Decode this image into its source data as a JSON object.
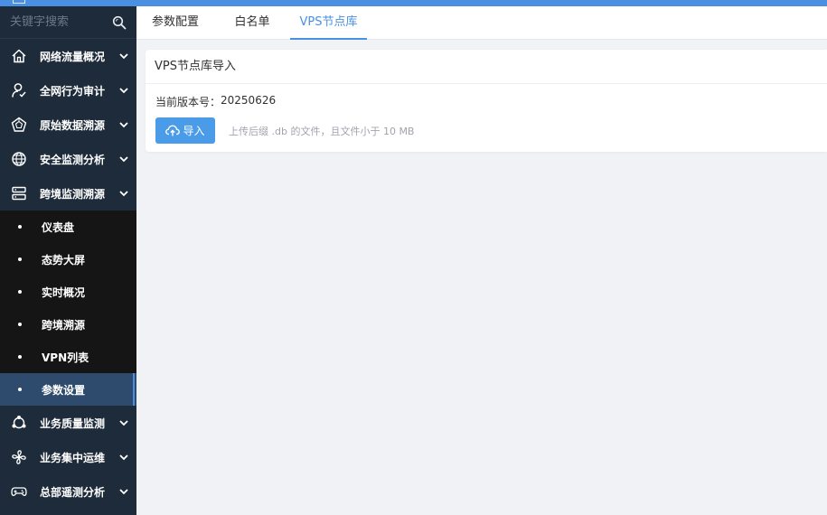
{
  "search": {
    "placeholder": "关键字搜索"
  },
  "sidebar": {
    "items_top": [
      {
        "label": "网络流量概况",
        "icon": "home-icon"
      },
      {
        "label": "全网行为审计",
        "icon": "user-audit-icon"
      },
      {
        "label": "原始数据溯源",
        "icon": "pentagon-icon"
      },
      {
        "label": "安全监测分析",
        "icon": "globe-icon"
      },
      {
        "label": "跨境监测溯源",
        "icon": "server-stack-icon"
      }
    ],
    "sub_items": [
      {
        "label": "仪表盘"
      },
      {
        "label": "态势大屏"
      },
      {
        "label": "实时概况"
      },
      {
        "label": "跨境溯源"
      },
      {
        "label": "VPN列表"
      },
      {
        "label": "参数设置",
        "active": true
      }
    ],
    "items_bottom": [
      {
        "label": "业务质量监测",
        "icon": "nodes-icon"
      },
      {
        "label": "业务集中运维",
        "icon": "fan-icon"
      },
      {
        "label": "总部遥测分析",
        "icon": "gamepad-icon"
      }
    ]
  },
  "tabs": [
    {
      "label": "参数配置"
    },
    {
      "label": "白名单"
    },
    {
      "label": "VPS节点库",
      "active": true
    }
  ],
  "card": {
    "title": "VPS节点库导入",
    "version_label": "当前版本号：",
    "version_value": "20250626",
    "import_label": "导入",
    "hint": "上传后缀 .db 的文件，且文件小于 10 MB"
  },
  "colors": {
    "accent": "#4a90e2",
    "sidebar_bg": "#1e2b3a",
    "submenu_bg": "#151515",
    "active_bg": "#2e4a6d"
  }
}
